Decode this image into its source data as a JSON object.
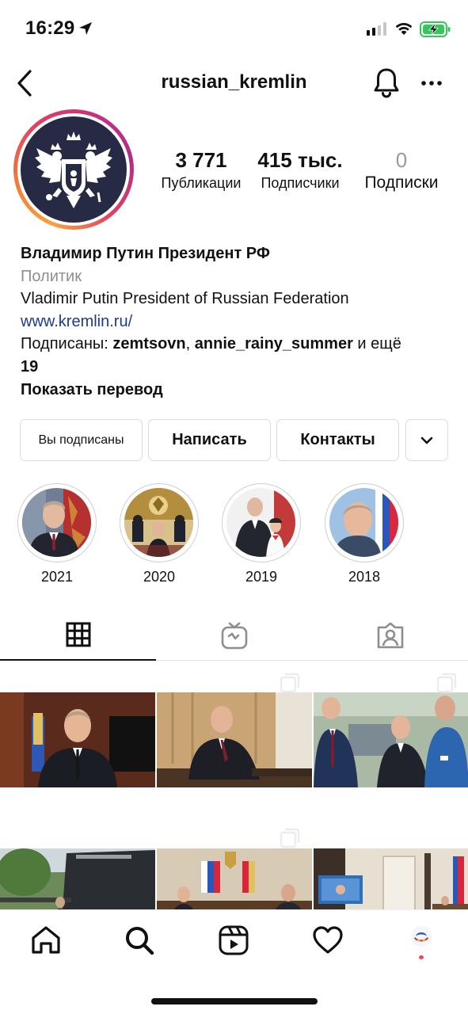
{
  "status_bar": {
    "time": "16:29"
  },
  "header": {
    "username": "russian_kremlin"
  },
  "profile": {
    "stats": [
      {
        "value": "3 771",
        "label": "Публикации"
      },
      {
        "value": "415 тыс.",
        "label": "Подписчики"
      },
      {
        "value": "0",
        "label": "Подписки"
      }
    ],
    "name": "Владимир Путин Президент РФ",
    "category": "Политик",
    "bio": "Vladimir Putin President of Russian Federation",
    "link": "www.kremlin.ru/",
    "followed_by_prefix": "Подписаны: ",
    "followed_by_user1": "zemtsovn",
    "followed_by_sep": ", ",
    "followed_by_user2": "annie_rainy_summer",
    "followed_by_suffix": " и ещё",
    "followed_by_count": "19",
    "show_translation": "Показать перевод"
  },
  "buttons": {
    "following": "Вы подписаны",
    "message": "Написать",
    "contacts": "Контакты"
  },
  "highlights": [
    {
      "label": "2021"
    },
    {
      "label": "2020"
    },
    {
      "label": "2019"
    },
    {
      "label": "2018"
    }
  ],
  "tabs": [
    "grid-icon",
    "igtv-icon",
    "tagged-icon"
  ],
  "bottom_nav": [
    "home-icon",
    "search-icon",
    "reels-icon",
    "activity-heart-icon",
    "profile-avatar"
  ],
  "colors": {
    "link": "#1e3a8a",
    "category_gray": "#8e8e8e",
    "story_ring": "#e23f60",
    "battery_green": "#34c759"
  }
}
